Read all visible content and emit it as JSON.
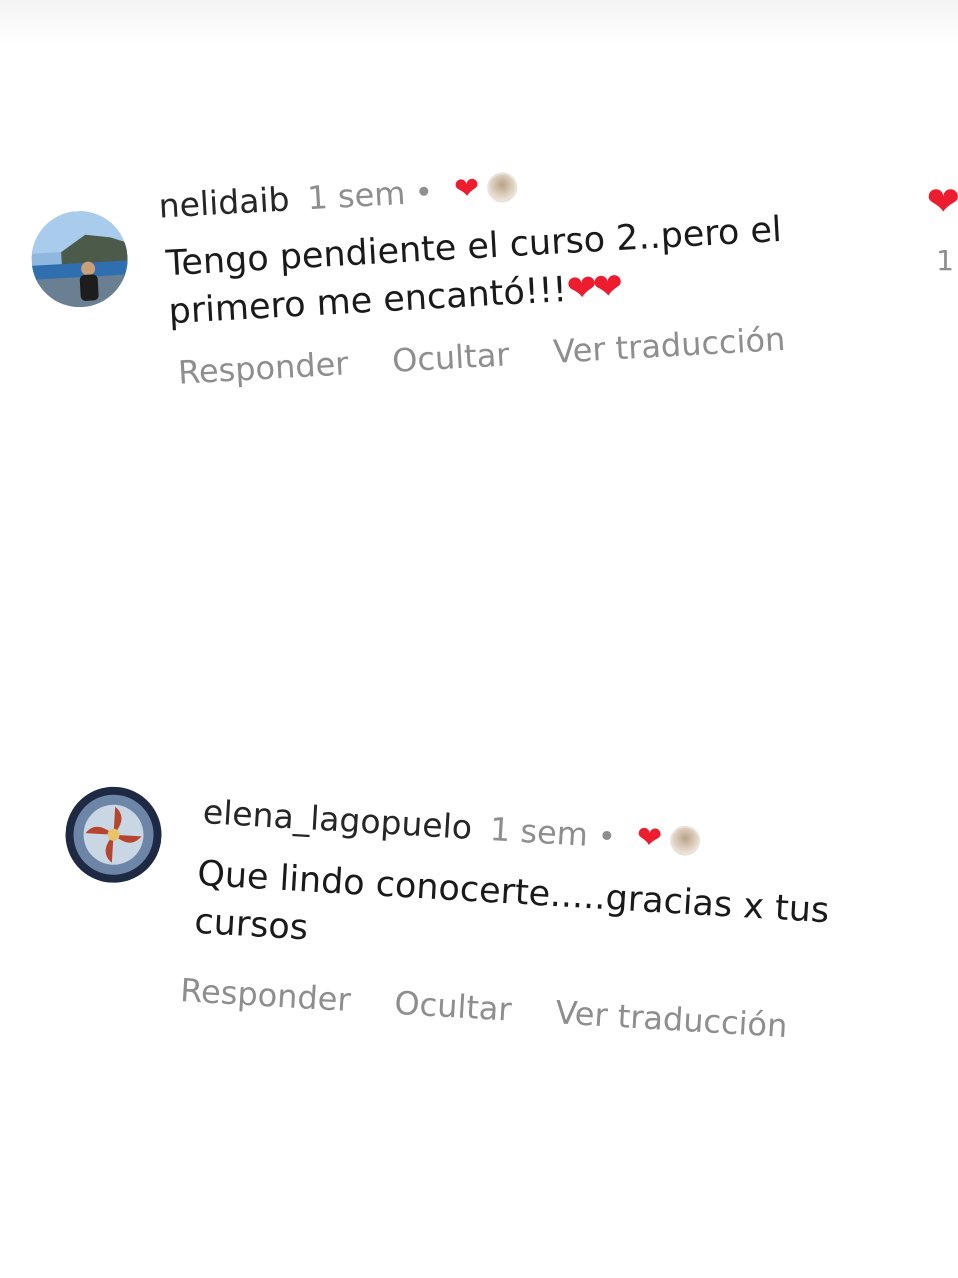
{
  "comments": [
    {
      "username": "nelidaib",
      "time": "1 sem",
      "text": "Tengo pendiente el curso 2..pero el primero me encantó!!!",
      "text_emoji": "❤❤",
      "actions": {
        "reply": "Responder",
        "hide": "Ocultar",
        "translate": "Ver traducción"
      },
      "like_icon": "heart-icon",
      "avatar_icon": "profile-photo"
    },
    {
      "username": "elena_lagopuelo",
      "time": "1 sem",
      "text": "Que lindo conocerte.....gracias x tus cursos",
      "actions": {
        "reply": "Responder",
        "hide": "Ocultar",
        "translate": "Ver traducción"
      },
      "like_icon": "heart-icon",
      "avatar_icon": "profile-photo"
    }
  ],
  "edge_like": {
    "count": "1"
  },
  "colors": {
    "heart": "#ed1c2e",
    "secondary_text": "#8e8e8e",
    "primary_text": "#262626"
  }
}
